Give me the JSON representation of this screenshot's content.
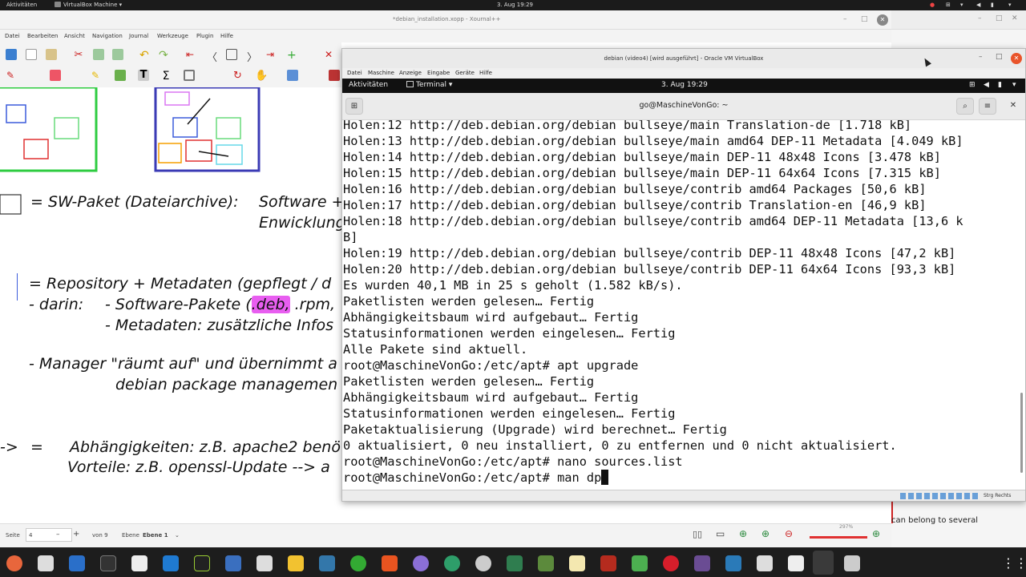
{
  "gnome_bar": {
    "activities": "Aktivitäten",
    "app_menu": "VirtualBox Machine",
    "clock": "3. Aug 19:29"
  },
  "xournal": {
    "title": "*debian_installation.xopp - Xournal++",
    "menu": [
      "Datei",
      "Bearbeiten",
      "Ansicht",
      "Navigation",
      "Journal",
      "Werkzeuge",
      "Plugin",
      "Hilfe"
    ],
    "notes": {
      "line1": "= SW-Paket (Dateiarchive):",
      "line1b": "Software +",
      "line1c": "Enwicklung",
      "line2": "= Repository + Metadaten  (gepflegt / d",
      "line3a": "- darin:",
      "line3b": "- Software-Pakete (",
      "line3hl": ".deb,",
      "line3c": " .rpm,",
      "line4": "- Metadaten: zusätzliche Infos",
      "line5": "- Manager \"räumt auf\" und übernimmt a",
      "line6": "debian package managemen",
      "line7a": "=",
      "line7b": "Abhängigkeiten: z.B. apache2 benö",
      "line8": "Vorteile:  z.B. openssl-Update --> a"
    },
    "status": {
      "page_label": "Seite",
      "page_value": "4",
      "page_of": "von 9",
      "layer_label": "Ebene",
      "layer_value": "Ebene 1",
      "zoom": "297%"
    }
  },
  "right_panel": {
    "text": "can belong to several"
  },
  "virtualbox": {
    "title": "debian (video4) [wird ausgeführt] - Oracle VM VirtualBox",
    "menu": [
      "Datei",
      "Maschine",
      "Anzeige",
      "Eingabe",
      "Geräte",
      "Hilfe"
    ],
    "host_key": "Strg Rechts",
    "guest": {
      "activities": "Aktivitäten",
      "app": "Terminal ▾",
      "clock": "3. Aug  19:29",
      "terminal_title": "go@MaschineVonGo: ~",
      "lines": [
        "Holen:12 http://deb.debian.org/debian bullseye/main Translation-de [1.718 kB]",
        "Holen:13 http://deb.debian.org/debian bullseye/main amd64 DEP-11 Metadata [4.049 kB]",
        "Holen:14 http://deb.debian.org/debian bullseye/main DEP-11 48x48 Icons [3.478 kB]",
        "Holen:15 http://deb.debian.org/debian bullseye/main DEP-11 64x64 Icons [7.315 kB]",
        "Holen:16 http://deb.debian.org/debian bullseye/contrib amd64 Packages [50,6 kB]",
        "Holen:17 http://deb.debian.org/debian bullseye/contrib Translation-en [46,9 kB]",
        "Holen:18 http://deb.debian.org/debian bullseye/contrib amd64 DEP-11 Metadata [13,6 k",
        "B]",
        "Holen:19 http://deb.debian.org/debian bullseye/contrib DEP-11 48x48 Icons [47,2 kB]",
        "Holen:20 http://deb.debian.org/debian bullseye/contrib DEP-11 64x64 Icons [93,3 kB]",
        "Es wurden 40,1 MB in 25 s geholt (1.582 kB/s).",
        "Paketlisten werden gelesen… Fertig",
        "Abhängigkeitsbaum wird aufgebaut… Fertig",
        "Statusinformationen werden eingelesen… Fertig",
        "Alle Pakete sind aktuell.",
        "root@MaschineVonGo:/etc/apt# apt upgrade",
        "Paketlisten werden gelesen… Fertig",
        "Abhängigkeitsbaum wird aufgebaut… Fertig",
        "Statusinformationen werden eingelesen… Fertig",
        "Paketaktualisierung (Upgrade) wird berechnet… Fertig",
        "0 aktualisiert, 0 neu installiert, 0 zu entfernen und 0 nicht aktualisiert.",
        "root@MaschineVonGo:/etc/apt# nano sources.list",
        "root@MaschineVonGo:/etc/apt# man dp"
      ]
    }
  }
}
